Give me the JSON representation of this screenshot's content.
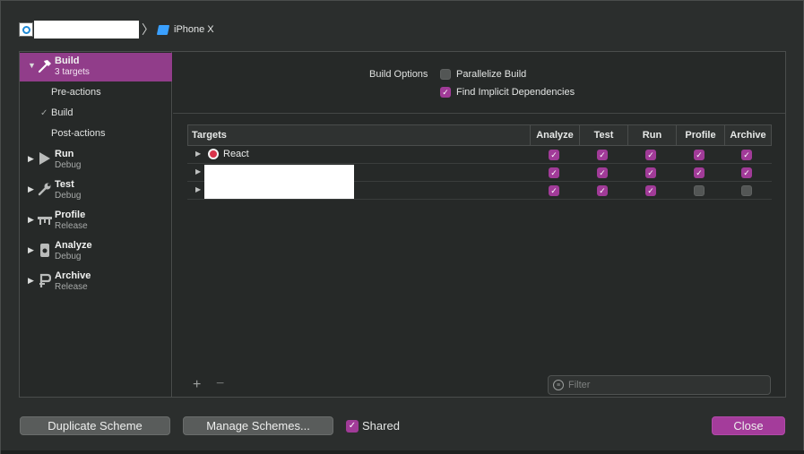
{
  "scheme": {
    "device_name": "iPhone X"
  },
  "sidebar": {
    "items": [
      {
        "title": "Build",
        "subtitle": "3 targets",
        "icon": "hammer-icon"
      },
      {
        "title": "Run",
        "subtitle": "Debug",
        "icon": "play-icon"
      },
      {
        "title": "Test",
        "subtitle": "Debug",
        "icon": "wrench-icon"
      },
      {
        "title": "Profile",
        "subtitle": "Release",
        "icon": "gauge-icon"
      },
      {
        "title": "Analyze",
        "subtitle": "Debug",
        "icon": "analyze-icon"
      },
      {
        "title": "Archive",
        "subtitle": "Release",
        "icon": "archive-icon"
      }
    ],
    "build_subitems": [
      "Pre-actions",
      "Build",
      "Post-actions"
    ]
  },
  "build_options": {
    "label": "Build Options",
    "parallelize": {
      "label": "Parallelize Build",
      "checked": false
    },
    "implicit": {
      "label": "Find Implicit Dependencies",
      "checked": true
    }
  },
  "targets_table": {
    "columns": [
      "Targets",
      "Analyze",
      "Test",
      "Run",
      "Profile",
      "Archive"
    ],
    "rows": [
      {
        "name": "React",
        "checks": [
          true,
          true,
          true,
          true,
          true
        ]
      },
      {
        "name": "",
        "checks": [
          true,
          true,
          true,
          true,
          true
        ]
      },
      {
        "name": "",
        "checks": [
          true,
          true,
          true,
          false,
          false
        ]
      }
    ]
  },
  "filter": {
    "placeholder": "Filter"
  },
  "footer": {
    "duplicate_label": "Duplicate Scheme",
    "manage_label": "Manage Schemes...",
    "shared_label": "Shared",
    "shared_checked": true,
    "close_label": "Close"
  },
  "colors": {
    "accent": "#a13b98",
    "selected_row": "#913d8a"
  }
}
